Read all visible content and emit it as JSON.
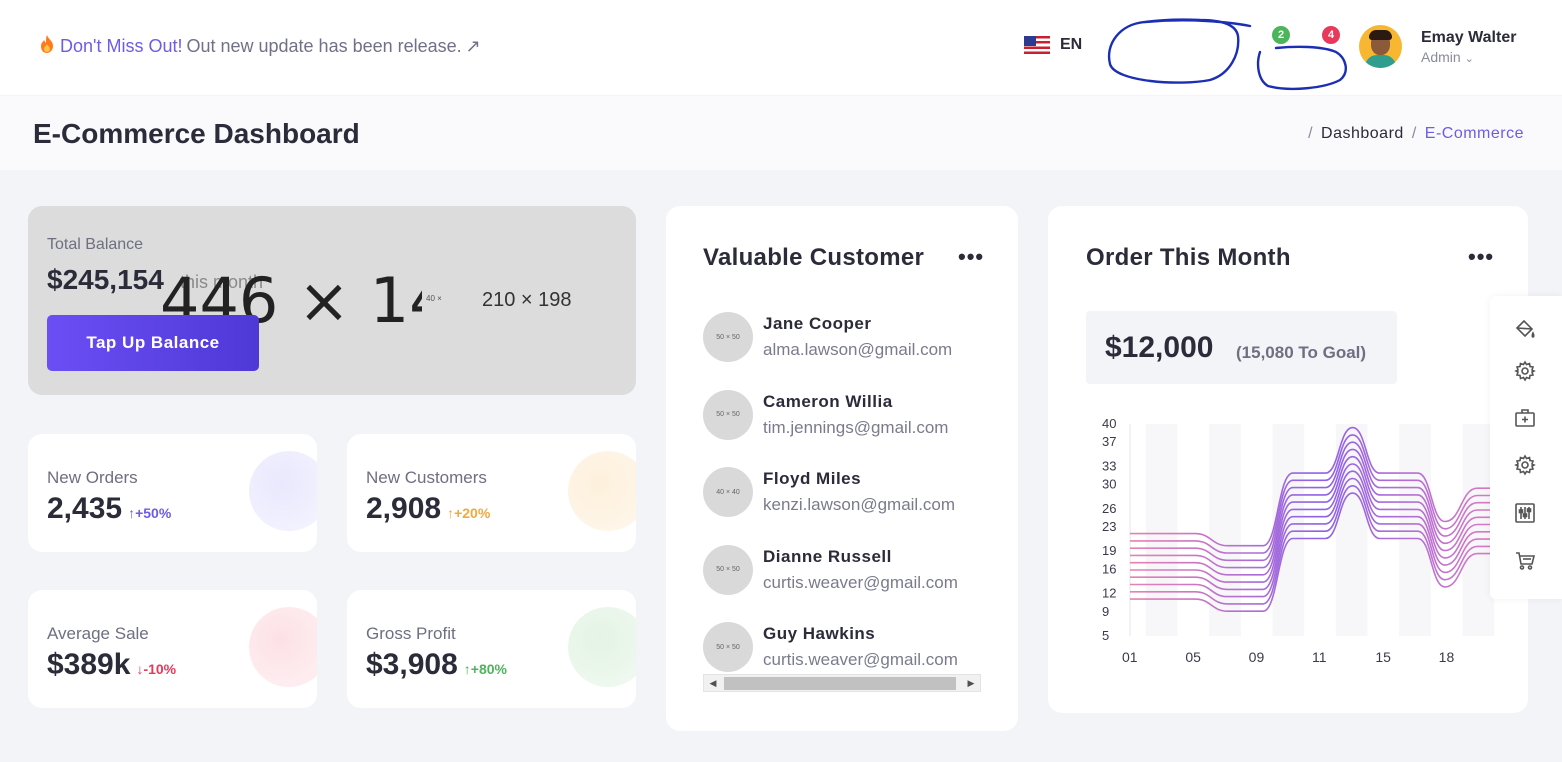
{
  "topbar": {
    "promo_highlight": "Don't Miss Out!",
    "promo_rest": "Out new update has been release.",
    "promo_arrow": "↗",
    "language": "EN",
    "notification_count_green": "2",
    "notification_count_red": "4",
    "user_name": "Emay Walter",
    "user_role": "Admin"
  },
  "page": {
    "title": "E-Commerce Dashboard",
    "breadcrumb": [
      "Dashboard",
      "E-Commerce"
    ]
  },
  "balance": {
    "label": "Total Balance",
    "value": "$245,154",
    "sub": "this month",
    "placeholder_large": "446 × 14",
    "placeholder_small": "40 ×",
    "placeholder_mid": "210 × 198",
    "button": "Tap Up Balance"
  },
  "stats": [
    {
      "label": "New Orders",
      "value": "2,435",
      "change": "+50%",
      "direction": "↑",
      "color": "#6c5ce7",
      "blob": "#ecebfd"
    },
    {
      "label": "New Customers",
      "value": "2,908",
      "change": "+20%",
      "direction": "↑",
      "color": "#f2a93b",
      "blob": "#fdf3e4"
    },
    {
      "label": "Average Sale",
      "value": "$389k",
      "change": "-10%",
      "direction": "↓",
      "color": "#e8395a",
      "blob": "#fde6ea"
    },
    {
      "label": "Gross Profit",
      "value": "$3,908",
      "change": "+80%",
      "direction": "↑",
      "color": "#4cb55a",
      "blob": "#e7f5e8"
    }
  ],
  "customers": {
    "title": "Valuable Customer",
    "menu": "•••",
    "items": [
      {
        "name": "Jane Cooper",
        "email": "alma.lawson@gmail.com",
        "pic": "50 × 50"
      },
      {
        "name": "Cameron Willia",
        "email": "tim.jennings@gmail.com",
        "pic": "50 × 50"
      },
      {
        "name": "Floyd Miles",
        "email": "kenzi.lawson@gmail.com",
        "pic": "40 × 40"
      },
      {
        "name": "Dianne Russell",
        "email": "curtis.weaver@gmail.com",
        "pic": "50 × 50"
      },
      {
        "name": "Guy Hawkins",
        "email": "curtis.weaver@gmail.com",
        "pic": "50 × 50"
      }
    ]
  },
  "orders": {
    "title": "Order This Month",
    "menu": "•••",
    "amount": "$12,000",
    "goal": "(15,080 To Goal)"
  },
  "chart_data": {
    "type": "line",
    "y_ticks": [
      5,
      9,
      12,
      16,
      19,
      23,
      26,
      30,
      33,
      37,
      40
    ],
    "x_ticks": [
      "01",
      "05",
      "09",
      "11",
      "15",
      "18"
    ],
    "ylim": [
      5,
      40
    ],
    "series_count": 10,
    "series_spacing": 1.2,
    "base_points": [
      {
        "x": 0,
        "y": 16.5
      },
      {
        "x": 1.2,
        "y": 16.5
      },
      {
        "x": 1.8,
        "y": 14.5
      },
      {
        "x": 2.45,
        "y": 14.5
      },
      {
        "x": 3.0,
        "y": 26.5
      },
      {
        "x": 3.6,
        "y": 26.5
      },
      {
        "x": 4.1,
        "y": 34.0
      },
      {
        "x": 4.6,
        "y": 26.5
      },
      {
        "x": 5.3,
        "y": 26.5
      },
      {
        "x": 5.8,
        "y": 18.5
      },
      {
        "x": 6.4,
        "y": 24.0
      },
      {
        "x": 7.0,
        "y": 24.0
      }
    ],
    "colors": {
      "start": "#e981b2",
      "mid": "#8d62e8",
      "end": "#e07cc0"
    }
  },
  "dock": {
    "icons": [
      "paint-bucket-icon",
      "gear-icon",
      "medical-kit-icon",
      "settings-icon",
      "sliders-icon",
      "cart-icon"
    ]
  }
}
